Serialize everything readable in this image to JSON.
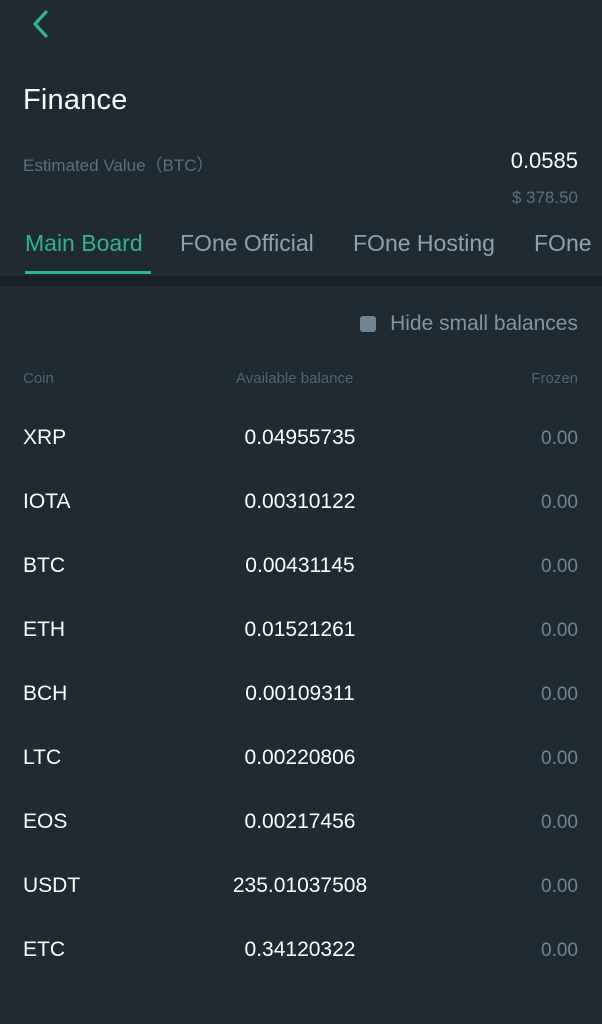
{
  "header": {
    "title": "Finance",
    "estimated_label": "Estimated Value（BTC）",
    "estimated_btc": "0.0585",
    "estimated_usd": "$ 378.50"
  },
  "tabs": [
    {
      "label": "Main Board",
      "active": true
    },
    {
      "label": "FOne Official",
      "active": false
    },
    {
      "label": "FOne Hosting",
      "active": false
    },
    {
      "label": "FOne",
      "active": false
    }
  ],
  "filter": {
    "hide_small_label": "Hide small balances"
  },
  "table": {
    "columns": [
      "Coin",
      "Available balance",
      "Frozen"
    ],
    "rows": [
      {
        "coin": "XRP",
        "available": "0.04955735",
        "frozen": "0.00"
      },
      {
        "coin": "IOTA",
        "available": "0.00310122",
        "frozen": "0.00"
      },
      {
        "coin": "BTC",
        "available": "0.00431145",
        "frozen": "0.00"
      },
      {
        "coin": "ETH",
        "available": "0.01521261",
        "frozen": "0.00"
      },
      {
        "coin": "BCH",
        "available": "0.00109311",
        "frozen": "0.00"
      },
      {
        "coin": "LTC",
        "available": "0.00220806",
        "frozen": "0.00"
      },
      {
        "coin": "EOS",
        "available": "0.00217456",
        "frozen": "0.00"
      },
      {
        "coin": "USDT",
        "available": "235.01037508",
        "frozen": "0.00"
      },
      {
        "coin": "ETC",
        "available": "0.34120322",
        "frozen": "0.00"
      }
    ]
  },
  "colors": {
    "background": "#1f2a33",
    "accent": "#2fb392",
    "muted": "#59707e"
  },
  "icons": {
    "back": "chevron-left-icon",
    "checkbox": "checkbox-icon"
  }
}
